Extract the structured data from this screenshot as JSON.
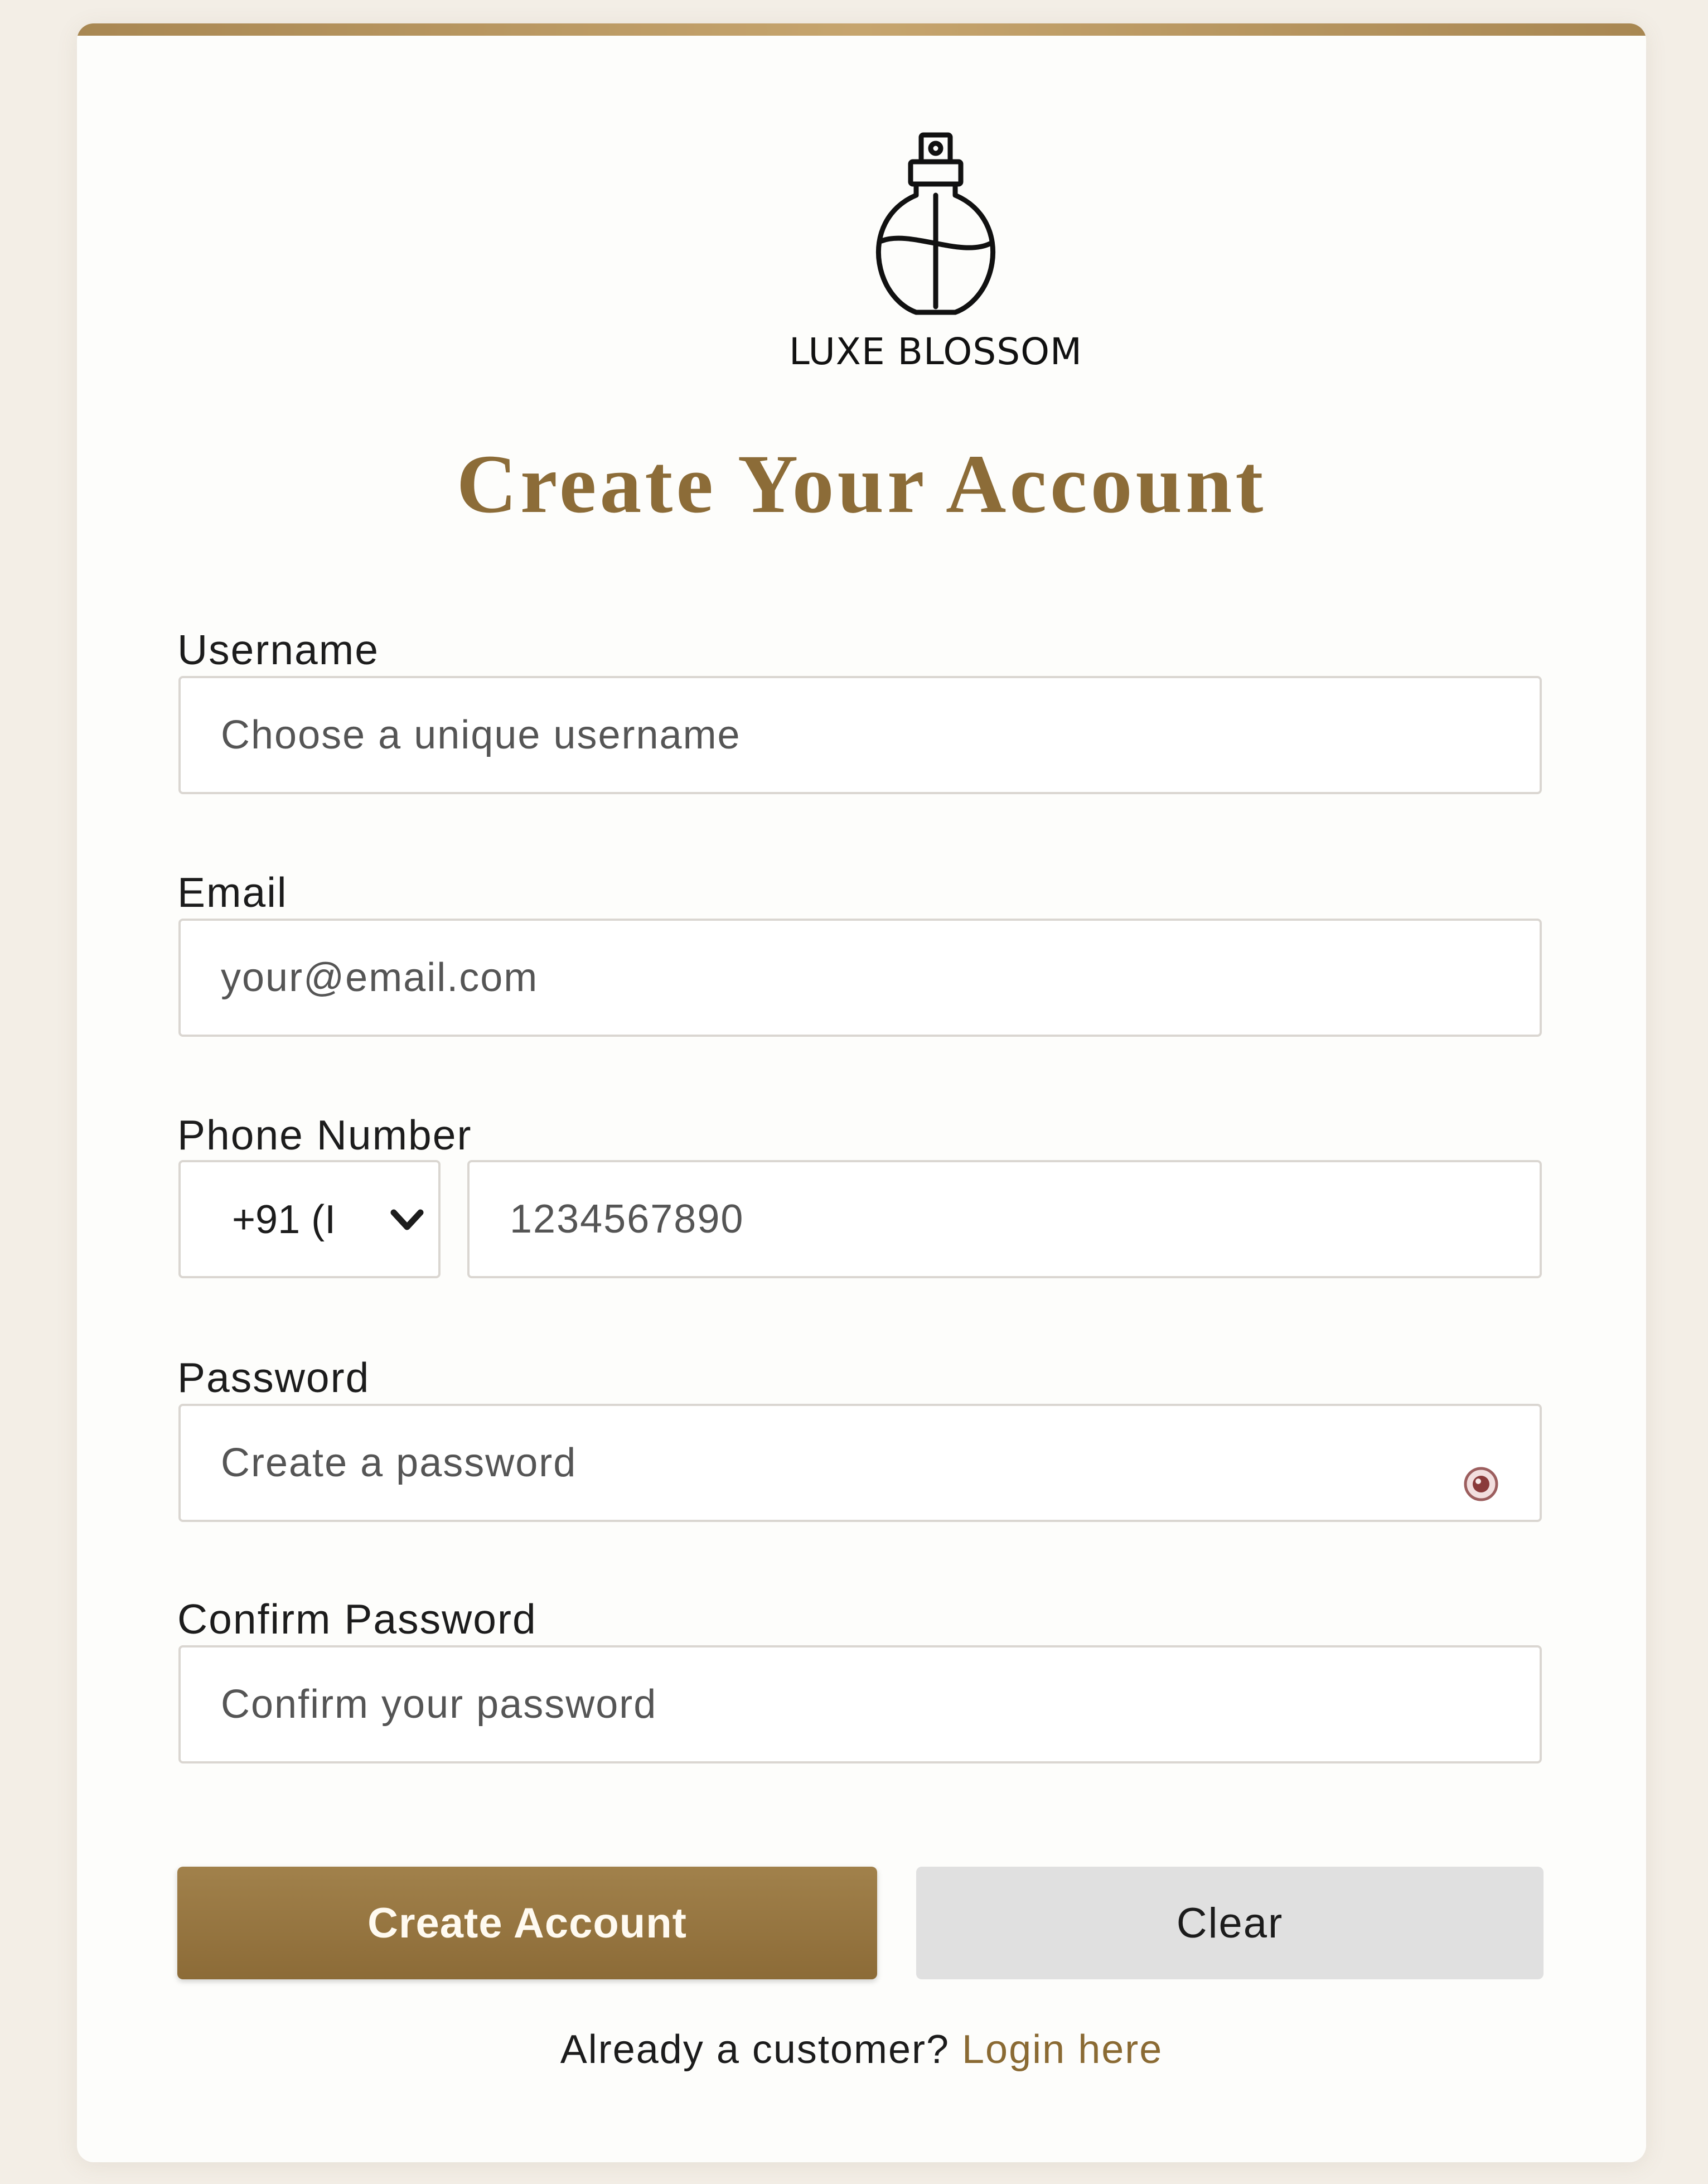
{
  "brand": {
    "name": "LUXE BLOSSOM",
    "logo_icon": "perfume-bottle-icon"
  },
  "page": {
    "title": "Create Your Account"
  },
  "form": {
    "username": {
      "label": "Username",
      "placeholder": "Choose a unique username",
      "value": ""
    },
    "email": {
      "label": "Email",
      "placeholder": "your@email.com",
      "value": ""
    },
    "phone": {
      "label": "Phone Number",
      "country_code_selected": "+91 (I",
      "placeholder": "1234567890",
      "value": ""
    },
    "password": {
      "label": "Password",
      "placeholder": "Create a password",
      "value": "",
      "toggle_icon": "eye-icon"
    },
    "confirm_password": {
      "label": "Confirm Password",
      "placeholder": "Confirm your password",
      "value": ""
    }
  },
  "actions": {
    "submit_label": "Create Account",
    "clear_label": "Clear"
  },
  "footer": {
    "prompt": "Already a customer? ",
    "login_link": "Login here"
  },
  "colors": {
    "accent": "#8c6c38",
    "background": "#f3eee6",
    "card": "#fdfdfb",
    "secondary_button": "#e0e0e0"
  }
}
